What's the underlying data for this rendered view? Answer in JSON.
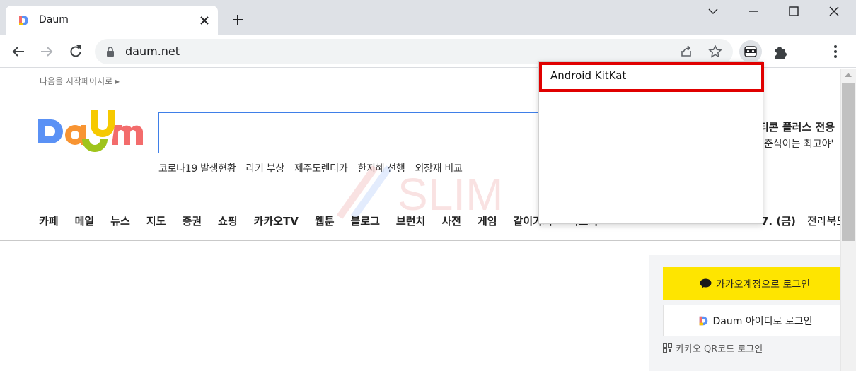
{
  "browser": {
    "tab": {
      "title": "Daum"
    },
    "omnibox": {
      "url": "daum.net"
    },
    "icons": [
      "daum-favicon",
      "close-icon",
      "plus-icon",
      "chevron-down-icon",
      "minimize-icon",
      "maximize-icon",
      "close-icon",
      "back-arrow-icon",
      "forward-arrow-icon",
      "reload-icon",
      "lock-icon",
      "share-icon",
      "star-icon",
      "user-agent-switcher-icon",
      "puzzle-icon",
      "more-vert-icon"
    ]
  },
  "page": {
    "start_page_link": "다음을 시작페이지로 ▸",
    "trending": [
      "코로나19 발생현황",
      "라키 부상",
      "제주도렌터카",
      "한지혜 선행",
      "외장재 비교"
    ],
    "promo": {
      "title": "티콘 플러스 전용",
      "subtitle": "'춘식이는 최고야'"
    },
    "gnb": [
      "카페",
      "메일",
      "뉴스",
      "지도",
      "증권",
      "쇼핑",
      "카카오TV",
      "웹툰",
      "블로그",
      "브런치",
      "사전",
      "게임",
      "같이가치",
      "더보기"
    ],
    "date": "7. (금)",
    "weather_region": "전라북도",
    "login": {
      "kakao_label": "카카오계정으로 로그인",
      "daum_label": "Daum 아이디로 로그인",
      "qr_label": "카카오 QR코드 로그인"
    },
    "watermark_text": "SLIM"
  },
  "popup": {
    "items": [
      "Android KitKat"
    ]
  },
  "colors": {
    "tabstrip": "#dee1e6",
    "search_border": "#3f7fe8",
    "kakao_yellow": "#fee500",
    "highlight_red": "#e00000",
    "logo_blue": "#5a91f5",
    "logo_orange": "#f89432",
    "logo_yellow": "#f6c900",
    "logo_green": "#9fc41c",
    "logo_pink": "#f36c6c"
  }
}
